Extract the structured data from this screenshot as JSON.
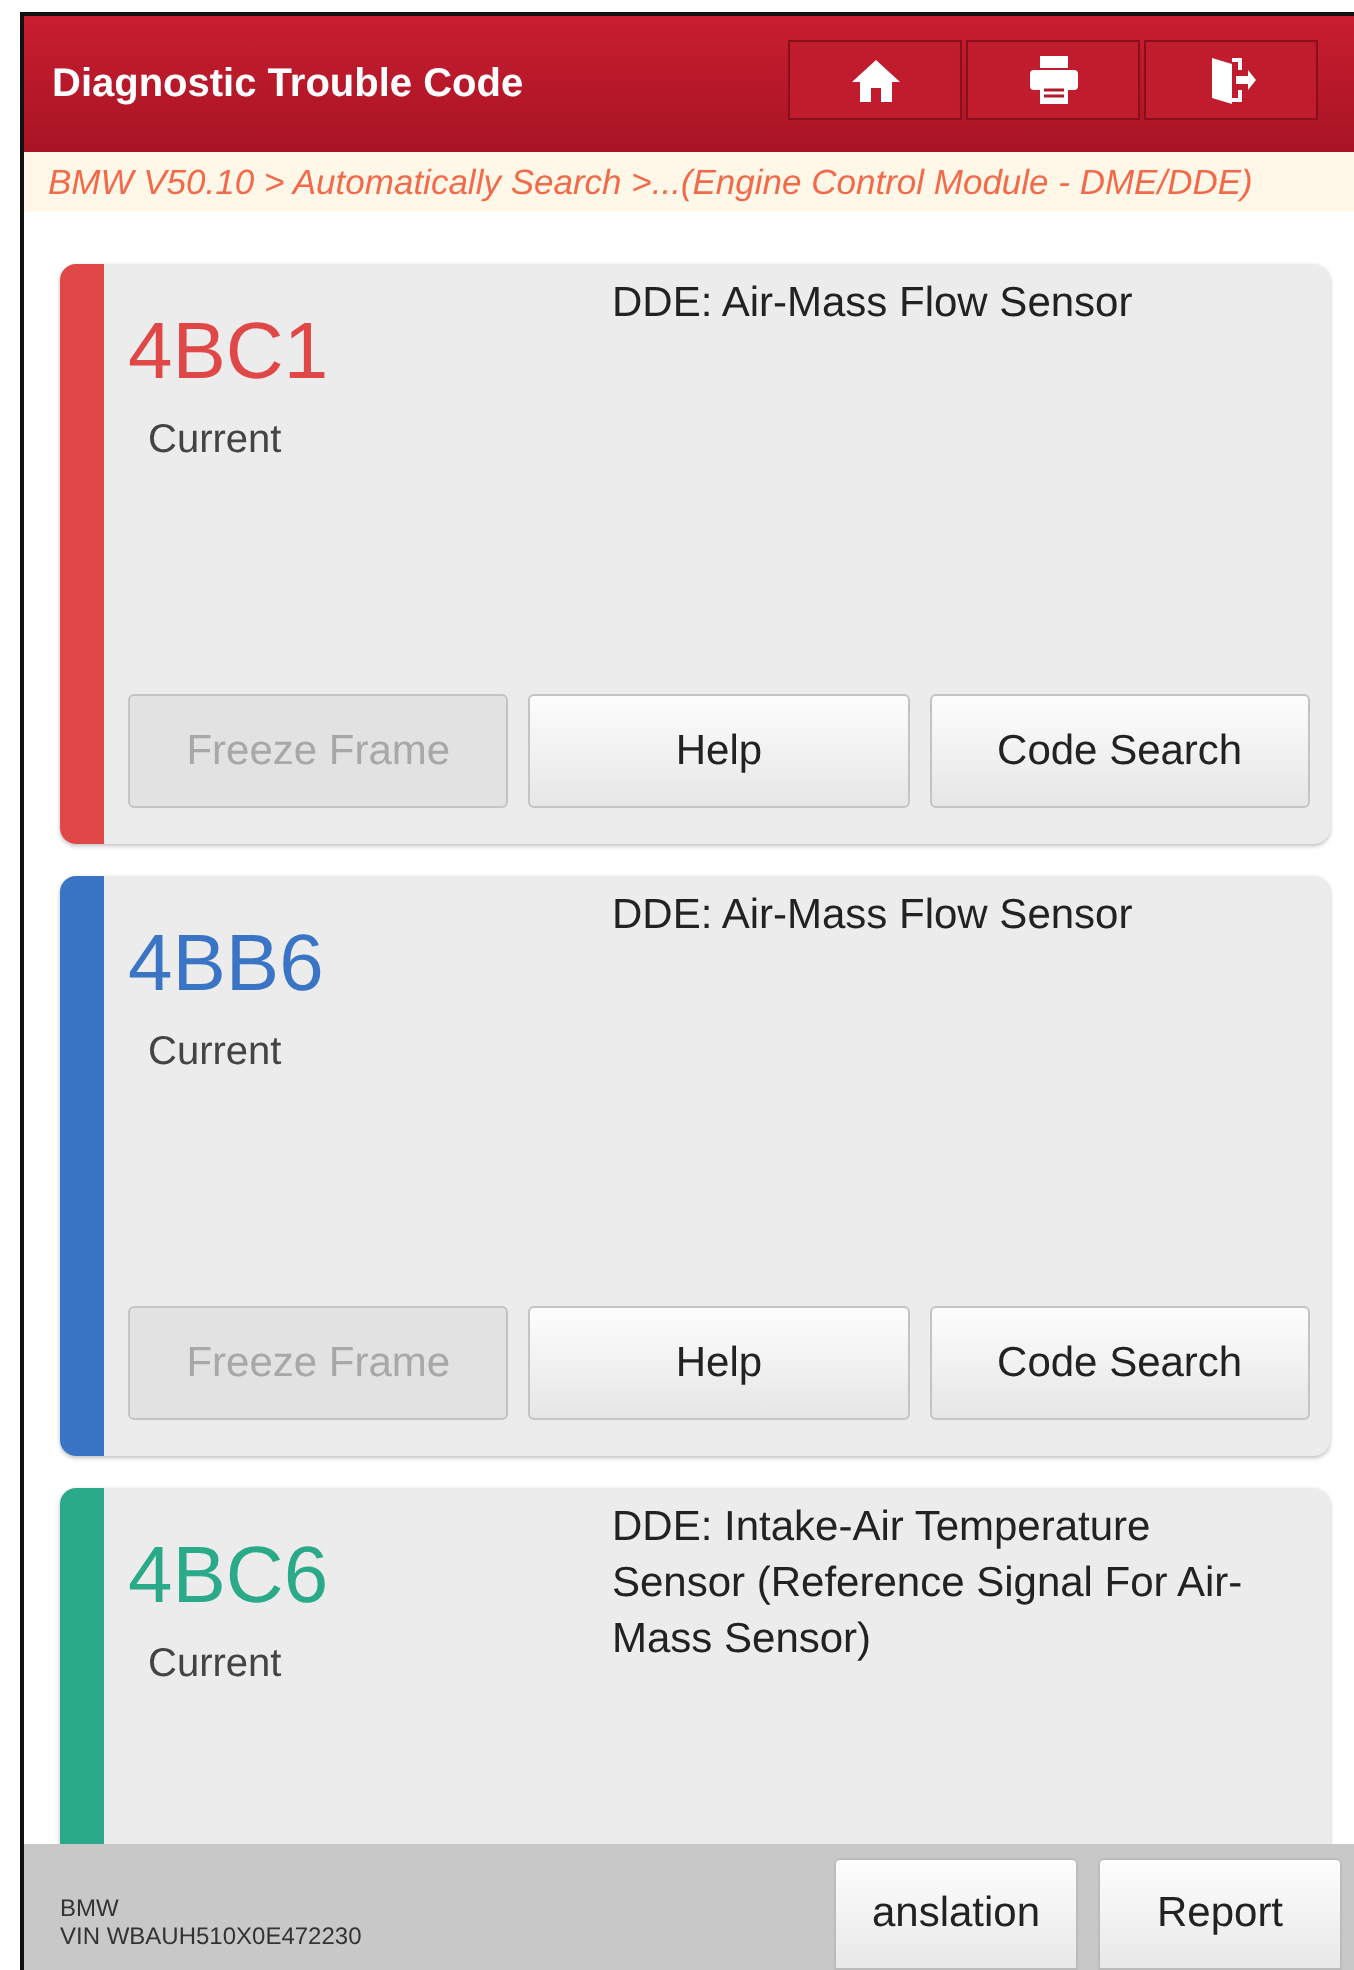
{
  "header": {
    "title": "Diagnostic Trouble Code"
  },
  "breadcrumb": "BMW V50.10 > Automatically Search >...(Engine Control Module - DME/DDE)",
  "codes": [
    {
      "code": "4BC1",
      "status": "Current",
      "description": "DDE: Air-Mass Flow Sensor",
      "color": "#e04848",
      "buttons": [
        {
          "label": "Freeze Frame",
          "disabled": true
        },
        {
          "label": "Help",
          "disabled": false
        },
        {
          "label": "Code Search",
          "disabled": false
        }
      ]
    },
    {
      "code": "4BB6",
      "status": "Current",
      "description": "DDE: Air-Mass Flow Sensor",
      "color": "#3a74c4",
      "buttons": [
        {
          "label": "Freeze Frame",
          "disabled": true
        },
        {
          "label": "Help",
          "disabled": false
        },
        {
          "label": "Code Search",
          "disabled": false
        }
      ]
    },
    {
      "code": "4BC6",
      "status": "Current",
      "description": "DDE: Intake-Air Temperature Sensor (Reference Signal For Air-Mass Sensor)",
      "color": "#2aaa88"
    }
  ],
  "footer": {
    "make": "BMW",
    "vin": "VIN WBAUH510X0E472230",
    "buttons": [
      "anslation",
      "Report"
    ]
  }
}
